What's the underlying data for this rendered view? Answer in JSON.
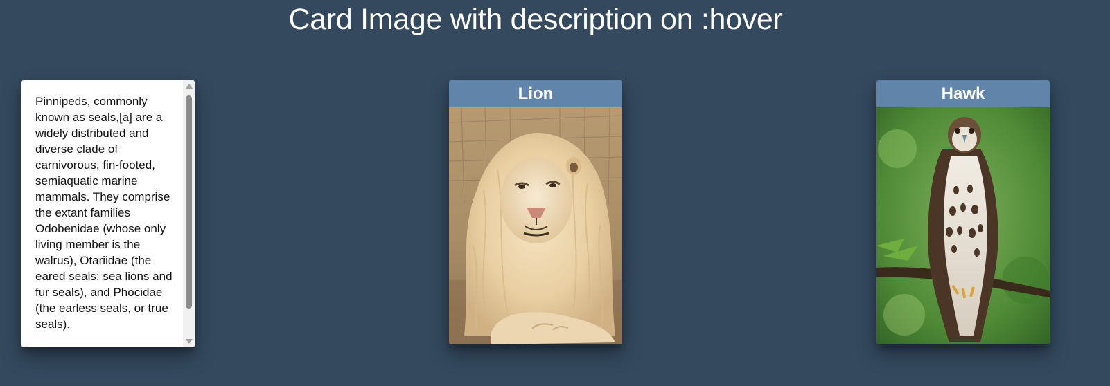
{
  "page": {
    "title": "Card Image with description on :hover"
  },
  "cards": [
    {
      "title": "",
      "description": "Pinnipeds, commonly known as seals,[a] are a widely distributed and diverse clade of carnivorous, fin-footed, semiaquatic marine mammals. They comprise the extant families Odobenidae (whose only living member is the walrus), Otariidae (the eared seals: sea lions and fur seals), and Phocidae (the earless seals, or true seals)."
    },
    {
      "title": "Lion",
      "image": "lion-photo"
    },
    {
      "title": "Hawk",
      "image": "hawk-photo"
    }
  ],
  "colors": {
    "background": "#34495e",
    "card_header": "#6184ab",
    "text_light": "#ffffff"
  }
}
